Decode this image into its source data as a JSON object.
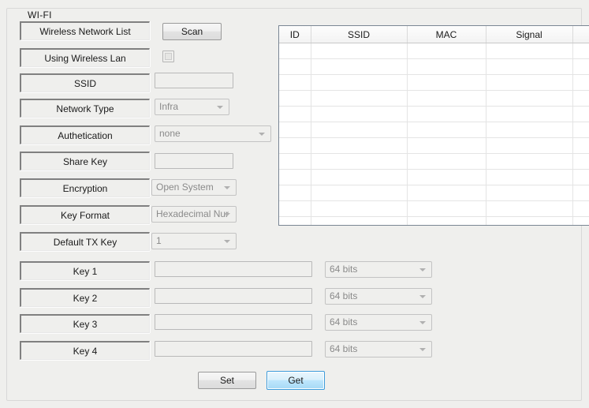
{
  "group": {
    "legend": "WI-FI"
  },
  "left_panel": {
    "rows": [
      {
        "label": "Wireless Network List",
        "control": "scan-button"
      },
      {
        "label": "Using Wireless Lan",
        "control": "checkbox"
      },
      {
        "label": "SSID",
        "control": "text",
        "value": ""
      },
      {
        "label": "Network Type",
        "control": "combo",
        "value": "Infra"
      },
      {
        "label": "Authetication",
        "control": "combo",
        "value": "none"
      },
      {
        "label": "Share Key",
        "control": "text",
        "value": ""
      },
      {
        "label": "Encryption",
        "control": "combo",
        "value": "Open System"
      },
      {
        "label": "Key Format",
        "control": "combo",
        "value": "Hexadecimal Nur"
      },
      {
        "label": "Default TX Key",
        "control": "combo",
        "value": "1"
      }
    ],
    "scan_button_label": "Scan"
  },
  "key_rows": [
    {
      "label": "Key 1",
      "value": "",
      "bits": "64 bits"
    },
    {
      "label": "Key 2",
      "value": "",
      "bits": "64 bits"
    },
    {
      "label": "Key 3",
      "value": "",
      "bits": "64 bits"
    },
    {
      "label": "Key 4",
      "value": "",
      "bits": "64 bits"
    }
  ],
  "actions": {
    "set_label": "Set",
    "get_label": "Get"
  },
  "network_table": {
    "columns": [
      "ID",
      "SSID",
      "MAC",
      "Signal",
      ""
    ],
    "rows": [],
    "empty_row_count": 12
  },
  "colors": {
    "panel_bg": "#efefed",
    "focus_blue": "#3c9bdb",
    "table_border": "#7a8694"
  }
}
